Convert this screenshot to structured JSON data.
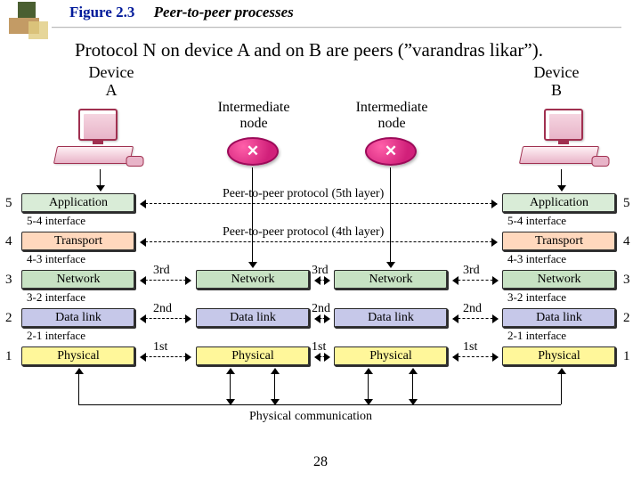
{
  "figure_label": "Figure 2.3",
  "figure_caption": "Peer-to-peer processes",
  "subtitle": "Protocol N on device A and on B are peers (”varandras likar”).",
  "devices": {
    "A": {
      "top": "Device",
      "bottom": "A"
    },
    "B": {
      "top": "Device",
      "bottom": "B"
    }
  },
  "intermediate": {
    "top": "Intermediate",
    "bottom": "node"
  },
  "x_glyph": "✕",
  "peer_labels": {
    "l5": "Peer-to-peer protocol (5th layer)",
    "l4": "Peer-to-peer protocol (4th layer)"
  },
  "hop_labels": {
    "l3": "3rd",
    "l2": "2nd",
    "l1": "1st"
  },
  "layers": {
    "5": {
      "name": "Application",
      "iface": "5-4 interface"
    },
    "4": {
      "name": "Transport",
      "iface": "4-3 interface"
    },
    "3": {
      "name": "Network",
      "iface": "3-2 interface"
    },
    "2": {
      "name": "Data link",
      "iface": "2-1 interface"
    },
    "1": {
      "name": "Physical",
      "iface": ""
    }
  },
  "physical_comm": "Physical communication",
  "numbers": [
    "5",
    "4",
    "3",
    "2",
    "1"
  ],
  "page": "28"
}
